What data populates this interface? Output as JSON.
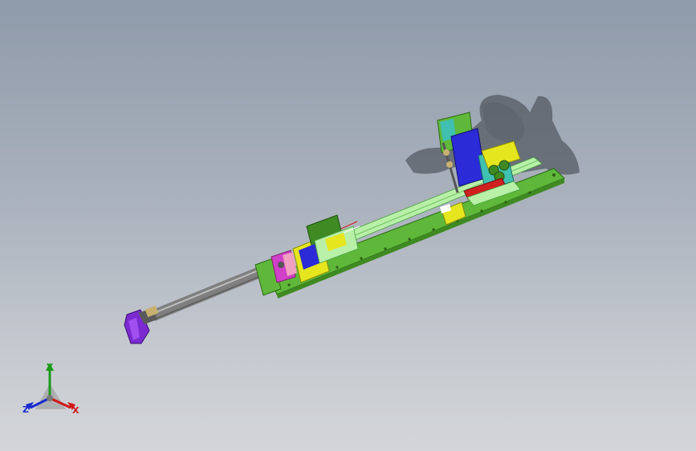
{
  "viewport": {
    "background_top": "#8f9aaa",
    "background_bottom": "#d3d5d8"
  },
  "model": {
    "colors": {
      "base_plate": "#5fb83a",
      "base_plate_dark": "#3f8a22",
      "rail": "#b8f0a8",
      "rod": "#7f7f7f",
      "rod_dark": "#555555",
      "purple": "#7a2ad0",
      "blue": "#2b2bd8",
      "magenta": "#d040c8",
      "pink": "#f0a0c0",
      "yellow": "#e6e61e",
      "teal": "#40c0b0",
      "red": "#d02020",
      "shadow": "#3a3f46"
    }
  },
  "triad": {
    "y_label": "Y",
    "z_label": "Z",
    "x_label": "X",
    "y_color": "#1a9a1a",
    "x_color": "#d01818",
    "z_color": "#1a2ad0"
  }
}
